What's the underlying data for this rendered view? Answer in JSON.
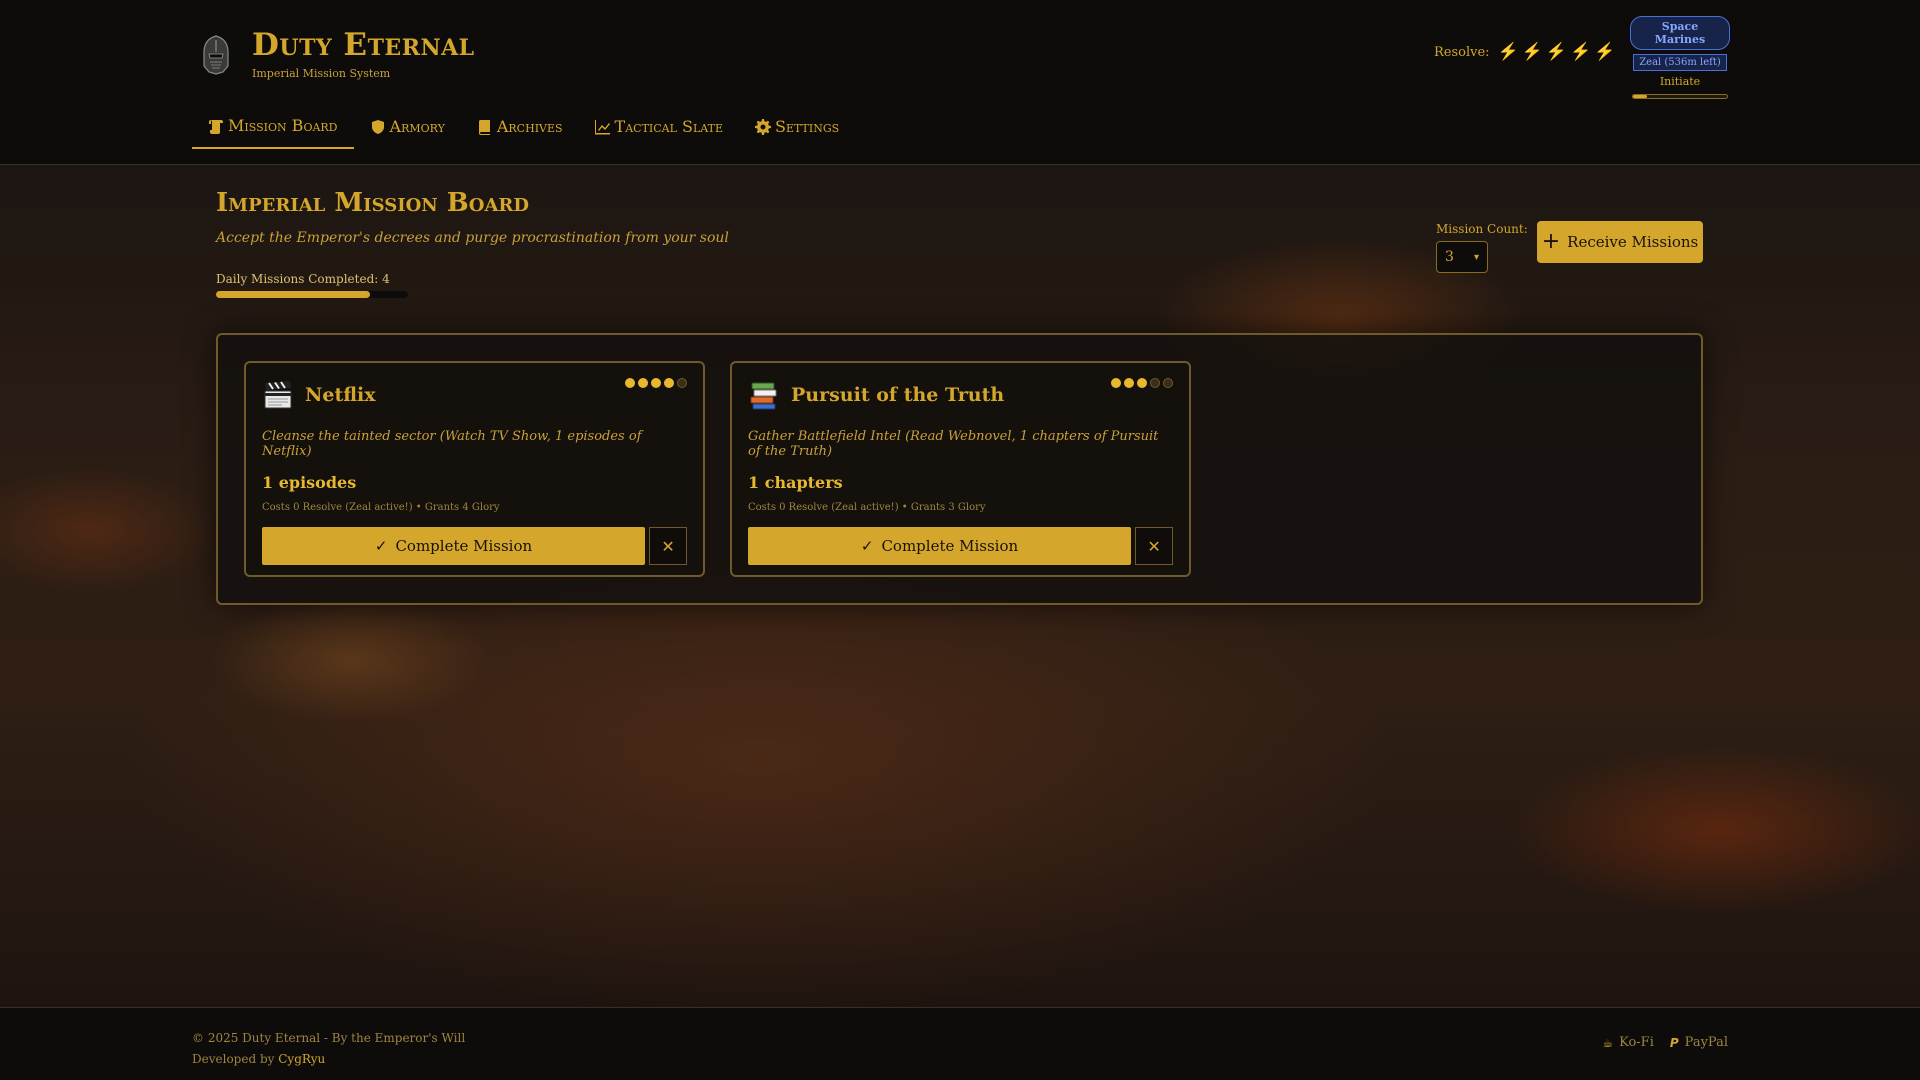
{
  "brand": {
    "title": "Duty Eternal",
    "subtitle": "Imperial Mission System"
  },
  "resolve": {
    "label": "Resolve:",
    "bolts": 5
  },
  "rank": {
    "faction": "Space Marines",
    "zeal": "Zeal (536m left)",
    "name": "Initiate",
    "progress": 0.15
  },
  "nav": [
    {
      "label": "Mission Board",
      "icon": "mission-board-icon",
      "active": true
    },
    {
      "label": "Armory",
      "icon": "shield-icon",
      "active": false
    },
    {
      "label": "Archives",
      "icon": "book-icon",
      "active": false
    },
    {
      "label": "Tactical Slate",
      "icon": "chart-line-icon",
      "active": false
    },
    {
      "label": "Settings",
      "icon": "gear-icon",
      "active": false
    }
  ],
  "page": {
    "title": "Imperial Mission Board",
    "subtitle": "Accept the Emperor's decrees and purge procrastination from your soul",
    "daily_label": "Daily Missions Completed: 4",
    "daily_progress": 0.8
  },
  "controls": {
    "count_label": "Mission Count:",
    "count_value": "3",
    "receive_label": "Receive Missions"
  },
  "missions": [
    {
      "icon": "clapperboard-icon",
      "title": "Netflix",
      "difficulty": 4,
      "difficulty_max": 5,
      "desc": "Cleanse the tainted sector (Watch TV Show, 1 episodes of Netflix)",
      "amount": "1 episodes",
      "costs": "Costs 0 Resolve (Zeal active!) • Grants 4 Glory",
      "complete_label": "Complete Mission"
    },
    {
      "icon": "books-icon",
      "title": "Pursuit of the Truth",
      "difficulty": 3,
      "difficulty_max": 5,
      "desc": "Gather Battlefield Intel (Read Webnovel, 1 chapters of Pursuit of the Truth)",
      "amount": "1 chapters",
      "costs": "Costs 0 Resolve (Zeal active!) • Grants 3 Glory",
      "complete_label": "Complete Mission"
    }
  ],
  "footer": {
    "copyright": "© 2025 Duty Eternal - By the Emperor's Will",
    "developed_by": "Developed by",
    "developer": "CygRyu",
    "kofi": "Ko-Fi",
    "paypal": "PayPal"
  },
  "colors": {
    "accent": "#d4a72c",
    "faction": "#86a6ff",
    "background": "#0d0c0b"
  }
}
